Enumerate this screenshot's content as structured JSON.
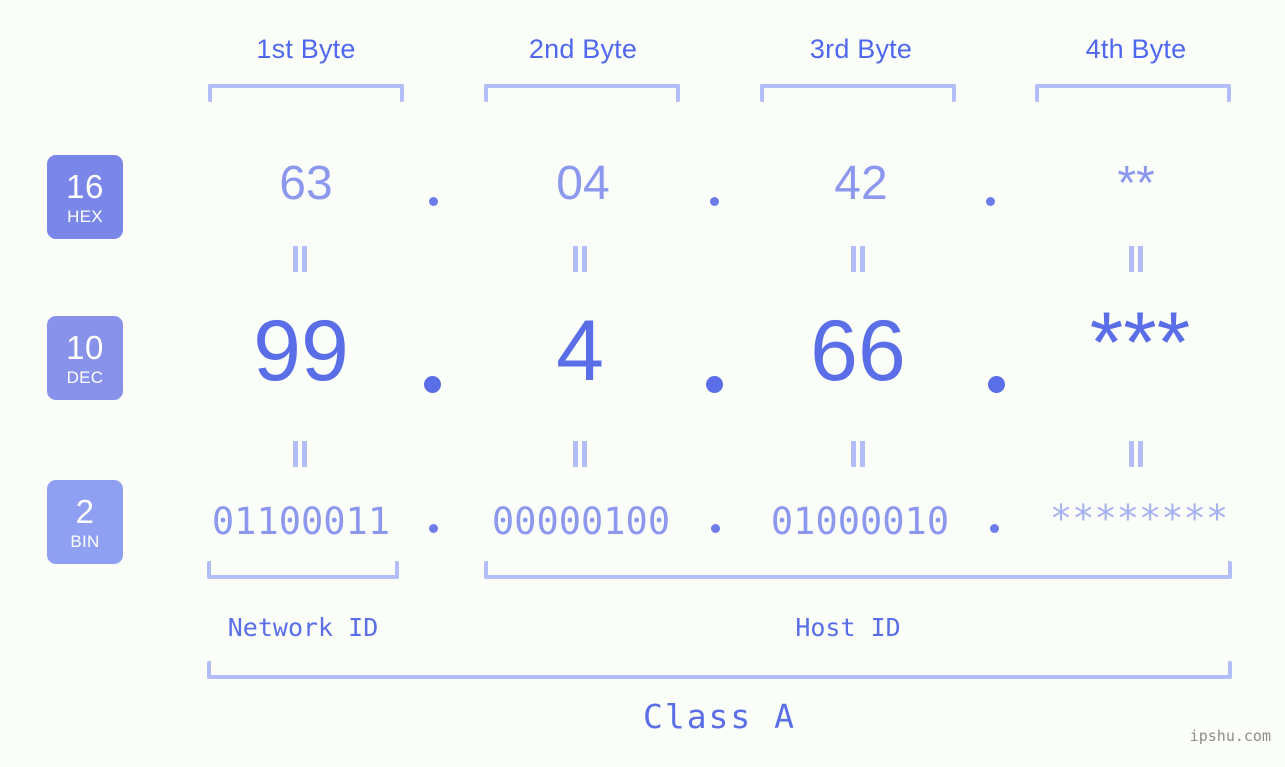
{
  "meta": {
    "watermark": "ipshu.com",
    "background_color": "#fbfdf9",
    "accent_color": "#5a6ee8",
    "accent_light_color": "#8b98ee",
    "bracket_color": "#b3bdf7",
    "badge_color": "#7b87e8"
  },
  "byte_headers": [
    {
      "label": "1st Byte"
    },
    {
      "label": "2nd Byte"
    },
    {
      "label": "3rd Byte"
    },
    {
      "label": "4th Byte"
    }
  ],
  "radix_badges": [
    {
      "num": "16",
      "abbr": "HEX"
    },
    {
      "num": "10",
      "abbr": "DEC"
    },
    {
      "num": "2",
      "abbr": "BIN"
    }
  ],
  "rows": {
    "hex": {
      "values": [
        "63",
        "04",
        "42",
        "**"
      ]
    },
    "dec": {
      "values": [
        "99",
        "4",
        "66",
        "***"
      ]
    },
    "bin": {
      "values": [
        "01100011",
        "00000100",
        "01000010",
        "********"
      ]
    }
  },
  "separators": {
    "dot": "."
  },
  "sections": [
    {
      "label": "Network ID"
    },
    {
      "label": "Host ID"
    }
  ],
  "class": {
    "label": "Class A"
  }
}
